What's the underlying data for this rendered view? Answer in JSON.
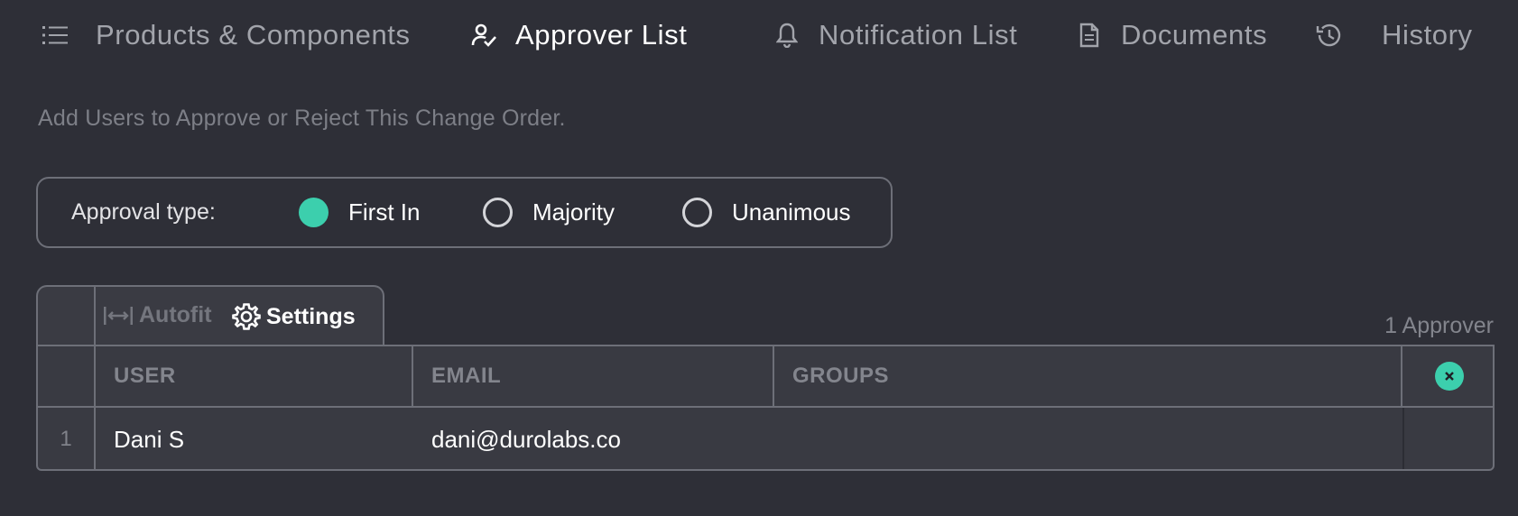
{
  "tabs": [
    {
      "label": "Products & Components",
      "icon": "list-icon",
      "active": false
    },
    {
      "label": "Approver List",
      "icon": "user-check-icon",
      "active": true
    },
    {
      "label": "Notification List",
      "icon": "bell-icon",
      "active": false
    },
    {
      "label": "Documents",
      "icon": "document-icon",
      "active": false
    },
    {
      "label": "History",
      "icon": "history-icon",
      "active": false
    }
  ],
  "helper_text": "Add Users to Approve or Reject This Change Order.",
  "approval": {
    "label": "Approval type:",
    "options": [
      {
        "label": "First In",
        "checked": true
      },
      {
        "label": "Majority",
        "checked": false
      },
      {
        "label": "Unanimous",
        "checked": false
      }
    ]
  },
  "toolbar": {
    "autofit_label": "Autofit",
    "settings_label": "Settings"
  },
  "approver_count": "1 Approver",
  "table": {
    "columns": [
      "USER",
      "EMAIL",
      "GROUPS"
    ],
    "rows": [
      {
        "index": "1",
        "user": "Dani S",
        "email": "dani@durolabs.co",
        "groups": ""
      }
    ]
  },
  "colors": {
    "background": "#2e2f37",
    "accent": "#3ccfad",
    "border": "#6d6f78"
  }
}
